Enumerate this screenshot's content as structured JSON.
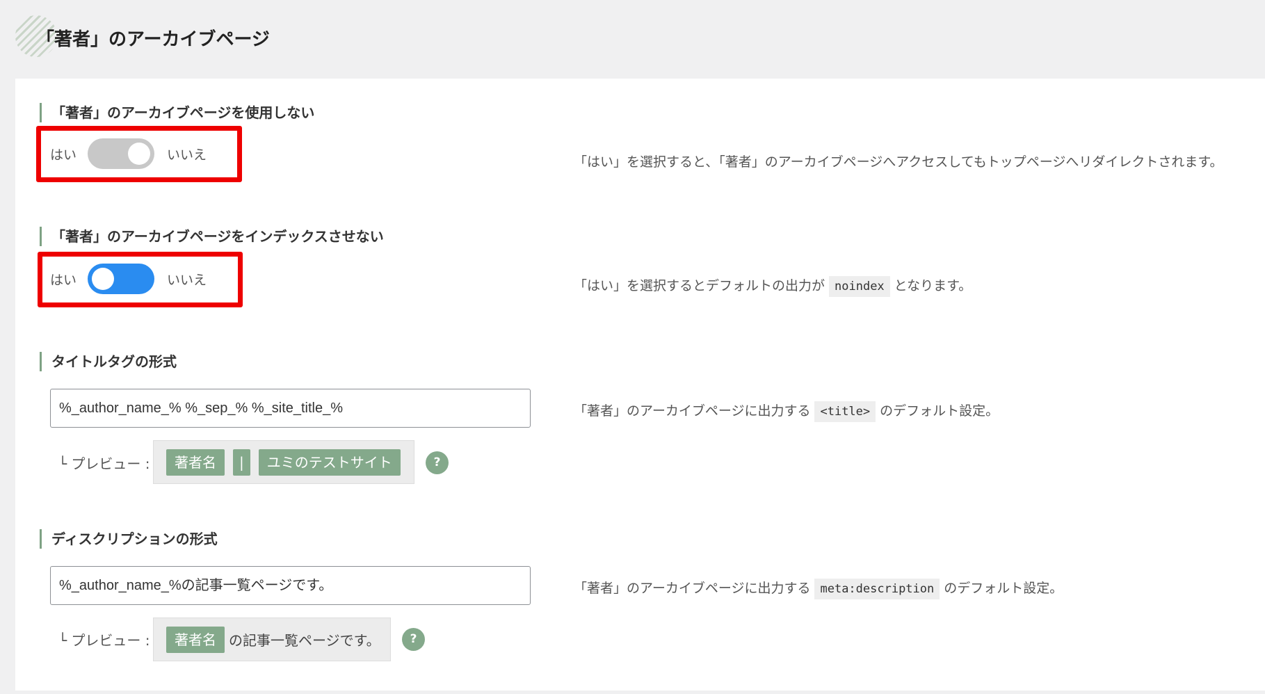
{
  "page": {
    "title": "「著者」のアーカイブページ"
  },
  "settings": {
    "disable_archive": {
      "label": "「著者」のアーカイブページを使用しない",
      "yes_label": "はい",
      "no_label": "いいえ",
      "state": "off",
      "description": "「はい」を選択すると、「著者」のアーカイブページへアクセスしてもトップページへリダイレクトされます。"
    },
    "noindex_archive": {
      "label": "「著者」のアーカイブページをインデックスさせない",
      "yes_label": "はい",
      "no_label": "いいえ",
      "state": "on",
      "description_pre": "「はい」を選択するとデフォルトの出力が",
      "description_code": "noindex",
      "description_post": "となります。"
    },
    "title_format": {
      "label": "タイトルタグの形式",
      "value": "%_author_name_% %_sep_% %_site_title_%",
      "preview_label": "└ プレビュー :",
      "preview_tags": [
        "著者名",
        "|",
        "ユミのテストサイト"
      ],
      "help": "?",
      "description_pre": "「著者」のアーカイブページに出力する",
      "description_code": "<title>",
      "description_post": "のデフォルト設定。"
    },
    "description_format": {
      "label": "ディスクリプションの形式",
      "value": "%_author_name_%の記事一覧ページです。",
      "preview_label": "└ プレビュー :",
      "preview_tag": "著者名",
      "preview_text": "の記事一覧ページです。",
      "help": "?",
      "description_pre": "「著者」のアーカイブページに出力する",
      "description_code": "meta:description",
      "description_post": "のデフォルト設定。"
    }
  },
  "colors": {
    "accent": "#84a98b",
    "toggle_on": "#2a8cf0",
    "toggle_off": "#c8c8c8",
    "highlight": "#ee0000"
  }
}
